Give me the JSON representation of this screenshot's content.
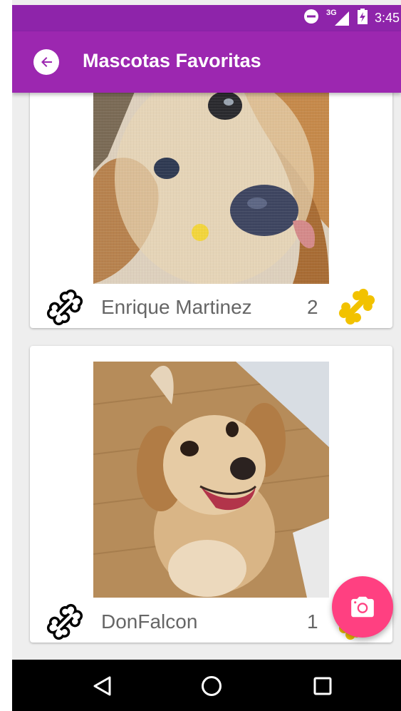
{
  "status_bar": {
    "time": "3:45",
    "network": "3G",
    "icons": [
      "do-not-disturb-icon",
      "signal-icon",
      "battery-icon"
    ]
  },
  "app_bar": {
    "title": "Mascotas Favoritas",
    "back_icon": "arrow-back-icon"
  },
  "pets": [
    {
      "name": "Enrique Martinez",
      "likes": "2"
    },
    {
      "name": "DonFalcon",
      "likes": "1"
    }
  ],
  "fab": {
    "icon": "camera-icon"
  },
  "nav_bar": {
    "icons": [
      "back-triangle-icon",
      "home-circle-icon",
      "recents-square-icon"
    ]
  },
  "colors": {
    "primary": "#9c27b0",
    "primary_dark": "#8e24aa",
    "accent": "#ff4081",
    "bone_yellow": "#f2c200"
  }
}
